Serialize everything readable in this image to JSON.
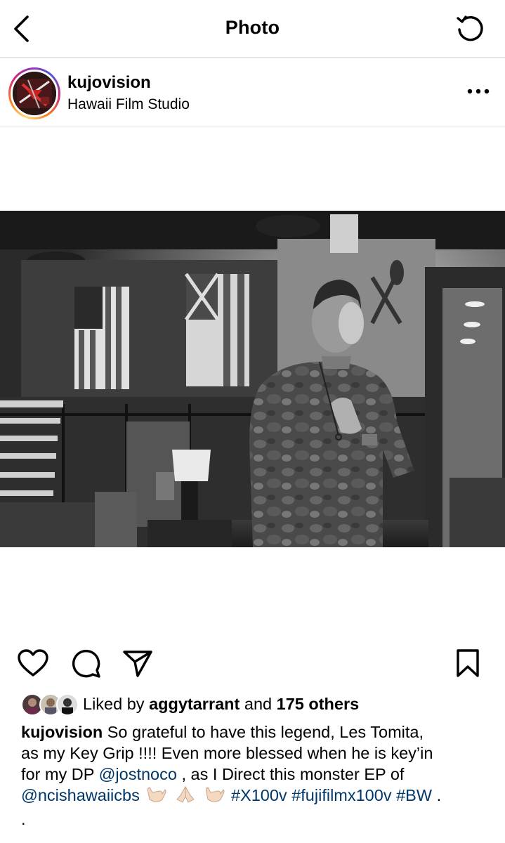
{
  "nav": {
    "title": "Photo",
    "back_icon": "chevron-left-icon",
    "refresh_icon": "refresh-icon"
  },
  "post": {
    "username": "kujovision",
    "location": "Hawaii Film Studio",
    "more_icon": "more-horizontal-icon",
    "photo_alt": "photo",
    "ring_colors": [
      "#feda75",
      "#fa7e1e",
      "#d62976",
      "#962fbf",
      "#4f5bd5"
    ]
  },
  "actions": {
    "like_icon": "heart-icon",
    "comment_icon": "comment-icon",
    "share_icon": "send-icon",
    "save_icon": "bookmark-icon"
  },
  "likes": {
    "prefix": "Liked by",
    "first_liker": "aggytarrant",
    "conjunction": "and",
    "others": "175 others"
  },
  "caption": {
    "author": "kujovision",
    "line1": "So grateful to have this legend, Les Tomita,",
    "line2": "as my Key Grip !!!! Even more blessed when he is key’in",
    "line3_prefix": "for my DP",
    "mention1": "@jostnoco",
    "line3_suffix": ", as I Direct this monster EP of",
    "mention2": "@ncishawaiicbs",
    "hashtag1": "#X100v",
    "hashtag2": "#fujifilmx100v",
    "hashtag3": "#BW",
    "line4_end": ".",
    "line5": "."
  },
  "colors": {
    "link": "#00376b",
    "divider": "#dbdbdb",
    "text": "#000000"
  }
}
